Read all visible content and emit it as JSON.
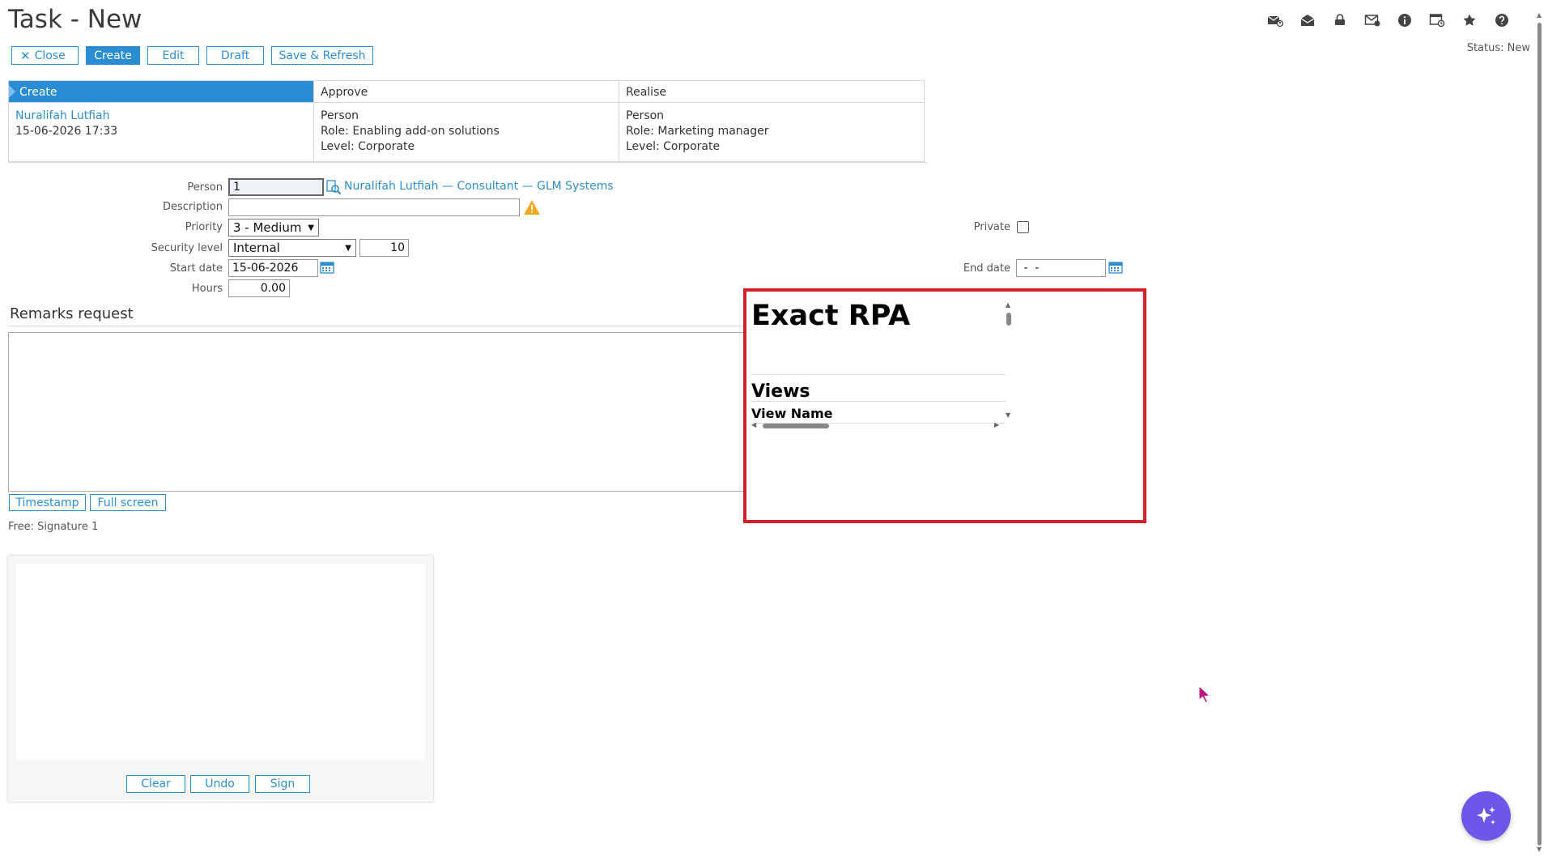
{
  "page": {
    "title": "Task - New",
    "status": "Status: New"
  },
  "top_icons": [
    "mail-person-icon",
    "mail-open-icon",
    "lock-hand-icon",
    "mail-check-icon",
    "info-icon",
    "card-history-icon",
    "star-icon",
    "help-icon"
  ],
  "toolbar": {
    "close": "Close",
    "create": "Create",
    "edit": "Edit",
    "draft": "Draft",
    "save_refresh": "Save & Refresh"
  },
  "workflow": {
    "steps": [
      {
        "name": "Create",
        "active": true,
        "lines": [
          "15-06-2026 17:33"
        ],
        "person_link": "Nuralifah Lutfiah"
      },
      {
        "name": "Approve",
        "active": false,
        "lines": [
          "Person",
          "Role: Enabling add-on solutions",
          "Level: Corporate"
        ]
      },
      {
        "name": "Realise",
        "active": false,
        "lines": [
          "Person",
          "Role: Marketing manager",
          "Level: Corporate"
        ]
      }
    ]
  },
  "form": {
    "person_label": "Person",
    "person_value": "1",
    "person_link": "Nuralifah Lutfiah — Consultant — GLM Systems",
    "description_label": "Description",
    "description_value": "",
    "priority_label": "Priority",
    "priority_value": "3 - Medium",
    "private_label": "Private",
    "security_label": "Security level",
    "security_value": "Internal",
    "security_number": "10",
    "start_label": "Start date",
    "start_value": "15-06-2026",
    "end_label": "End date",
    "end_value": " -  -",
    "hours_label": "Hours",
    "hours_value": "0.00"
  },
  "remarks": {
    "title": "Remarks request",
    "timestamp": "Timestamp",
    "fullscreen": "Full screen"
  },
  "signature": {
    "label": "Free: Signature 1",
    "clear": "Clear",
    "undo": "Undo",
    "sign": "Sign"
  },
  "rpa": {
    "title": "Exact RPA",
    "views": "Views",
    "column": "View Name"
  },
  "colors": {
    "accent": "#2a8dd4",
    "link": "#2f8fce",
    "rpa_border": "#d0202a",
    "fab": "#6e57e8"
  }
}
